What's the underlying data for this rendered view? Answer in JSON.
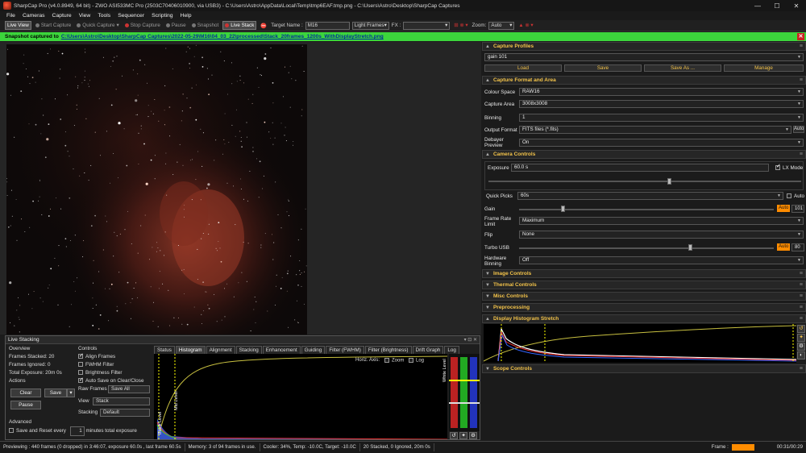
{
  "window": {
    "title": "SharpCap Pro (v4.0.8949, 64 bit) - ZWO ASI533MC Pro (2503C70406010900, via USB3) - C:\\Users\\Astro\\AppData\\Local\\Temp\\tmp6EAF.tmp.png - C:\\Users\\Astro\\Desktop\\SharpCap Captures",
    "min": "—",
    "max": "☐",
    "close": "✕"
  },
  "menu": [
    "File",
    "Cameras",
    "Capture",
    "View",
    "Tools",
    "Sequencer",
    "Scripting",
    "Help"
  ],
  "toolbar": {
    "live_view": "Live View",
    "start_capture": "Start Capture",
    "quick_capture": "Quick Capture",
    "stop_capture": "Stop Capture",
    "pause": "Pause",
    "snapshot": "Snapshot",
    "live_stack": "Live Stack",
    "target_label": "Target Name :",
    "target_value": "M16",
    "frames_value": "Light Frames",
    "fx_label": "FX :",
    "zoom_label": "Zoom:",
    "zoom_value": "Auto"
  },
  "notification": {
    "prefix": "Snapshot captured to",
    "path": "C:\\Users\\Astro\\Desktop\\SharpCap Captures\\2022-05-29\\M16\\04_03_22\\processed\\Stack_20frames_1200s_WithDisplayStretch.png",
    "close": "✕"
  },
  "live_stacking": {
    "header": "Live Stacking",
    "header_controls": "▾ ⊡ ✕",
    "overview_title": "Overview",
    "frames_stacked": "Frames Stacked: 20",
    "frames_ignored": "Frames Ignored: 0",
    "total_exposure": "Total Exposure:   20m 0s",
    "actions_title": "Actions",
    "clear": "Clear",
    "save": "Save",
    "pause": "Pause",
    "advanced_title": "Advanced",
    "save_reset_label": "Save and Reset every",
    "save_reset_value": "1",
    "save_reset_suffix": "minutes total exposure",
    "controls_title": "Controls",
    "align_frames": "Align Frames",
    "fwhm_filter": "FWHM Filter",
    "brightness_filter": "Brightness Filter",
    "auto_save": "Auto Save on Clear/Close",
    "raw_frames_label": "Raw Frames",
    "raw_frames_value": "Save All",
    "view_label": "View",
    "view_value": "Stack",
    "stacking_label": "Stacking",
    "stacking_value": "Default",
    "tabs": [
      "Status",
      "Histogram",
      "Alignment",
      "Stacking",
      "Enhancement",
      "Guiding",
      "Filter (FWHM)",
      "Filter (Brightness)",
      "Drift Graph",
      "Log"
    ],
    "active_tab": "Histogram",
    "horiz_axis": "Horiz. Axis:",
    "zoom": "Zoom",
    "log": "Log",
    "white_level": "White Level",
    "mid_level": "Mid Level",
    "black_level": "Black Level"
  },
  "right_panel": {
    "capture_profiles": "Capture Profiles",
    "profile_value": "gain 101",
    "load": "Load",
    "save": "Save",
    "save_as": "Save As ...",
    "manage": "Manage",
    "capture_format": "Capture Format and Area",
    "colour_space_label": "Colour Space",
    "colour_space_value": "RAW16",
    "capture_area_label": "Capture Area",
    "capture_area_value": "3008x3008",
    "binning_label": "Binning",
    "binning_value": "1",
    "output_format_label": "Output Format",
    "output_format_value": "FITS files (*.fits)",
    "output_auto": "Auto",
    "debayer_label": "Debayer Preview",
    "debayer_value": "On",
    "camera_controls": "Camera Controls",
    "exposure_label": "Exposure",
    "exposure_value": "60.0 s",
    "lx_mode": "LX Mode",
    "quick_picks_label": "Quick Picks",
    "quick_picks_value": "60s",
    "quick_auto": "Auto",
    "gain_label": "Gain",
    "gain_auto": "Auto",
    "gain_value": "101",
    "frame_rate_label": "Frame Rate Limit",
    "frame_rate_value": "Maximum",
    "flip_label": "Flip",
    "flip_value": "None",
    "turbo_label": "Turbo USB",
    "turbo_auto": "Auto",
    "turbo_value": "80",
    "hw_binning_label": "Hardware Binning",
    "hw_binning_value": "Off",
    "image_controls": "Image Controls",
    "thermal_controls": "Thermal Controls",
    "misc_controls": "Misc Controls",
    "preprocessing": "Preprocessing",
    "display_stretch": "Display Histogram Stretch",
    "scope_controls": "Scope Controls"
  },
  "status": {
    "previewing": "Previewing : 440 frames (0 dropped) in 3:46:07, exposure 60.0s , last frame 60.5s",
    "memory": "Memory: 3 of 94 frames in use.",
    "cooler": "Cooler: 34%, Temp: -10.0C, Target: -10.0C",
    "stacked": "20 Stacked, 0 Ignored, 20m 0s",
    "frame_label": "Frame :",
    "time": "00:31/00:29"
  },
  "colors": {
    "accent": "#f3c34a",
    "notify": "#3cd53c",
    "auto": "#ff8c00"
  }
}
